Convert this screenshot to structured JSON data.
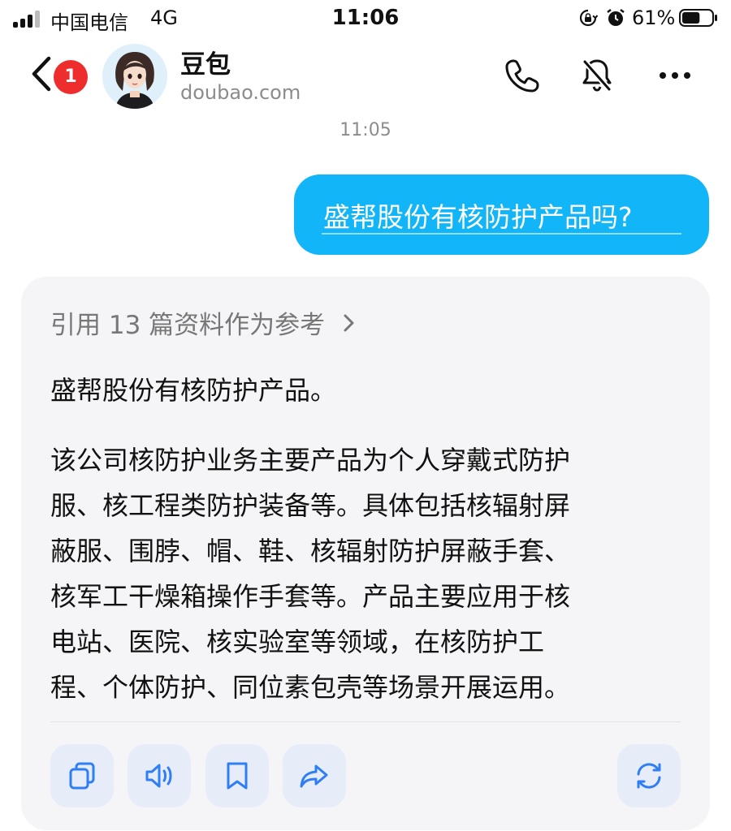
{
  "status_bar": {
    "carrier": "中国电信",
    "network": "4G",
    "time": "11:06",
    "battery_percent": "61%",
    "battery_level": 0.61,
    "icons": [
      "signal-icon",
      "rotation-lock-icon",
      "alarm-icon",
      "battery-icon"
    ]
  },
  "header": {
    "unread_count": "1",
    "contact_name": "豆包",
    "contact_subtitle": "doubao.com",
    "icons": [
      "back-chevron-icon",
      "phone-icon",
      "mute-icon",
      "more-icon"
    ]
  },
  "chat": {
    "timestamp": "11:05",
    "user_message": "盛帮股份有核防护产品吗?",
    "reply": {
      "references_label": "引用 13 篇资料作为参考",
      "summary": "盛帮股份有核防护产品。",
      "body_lines": [
        "该公司核防护业务主要产品为个人穿戴式防护",
        "服、核工程类防护装备等。具体包括核辐射屏",
        "蔽服、围脖、帽、鞋、核辐射防护屏蔽手套、",
        "核军工干燥箱操作手套等。产品主要应用于核",
        "电站、医院、核实验室等领域，在核防护工",
        "程、个体防护、同位素包壳等场景开展运用。"
      ],
      "actions": [
        "copy-icon",
        "speaker-icon",
        "bookmark-icon",
        "share-icon",
        "regenerate-icon"
      ]
    }
  },
  "colors": {
    "user_bubble": "#12b5f7",
    "badge": "#ee2d2d",
    "action_icon": "#2f7ef5",
    "card_bg": "#f5f5f7"
  }
}
